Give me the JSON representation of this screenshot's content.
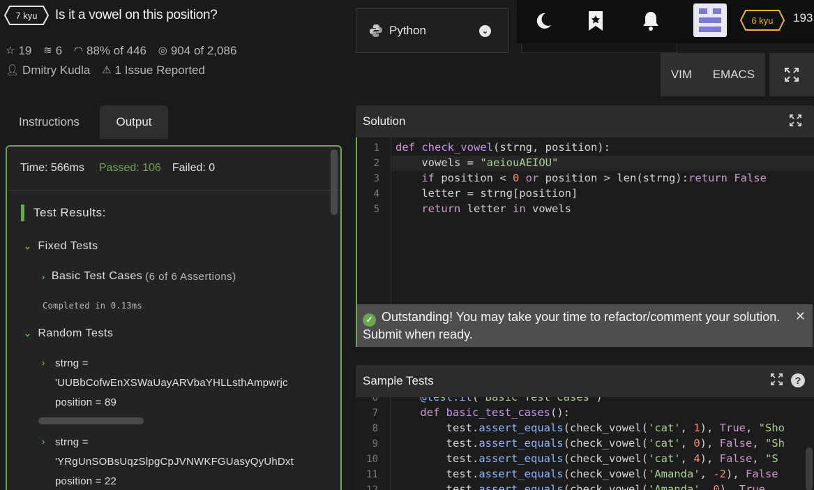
{
  "kata": {
    "rank": "7 kyu",
    "title": "Is it a vowel on this position?",
    "stars": "19",
    "collections": "6",
    "satisfaction_pct": "88%",
    "satisfaction_of": "of 446",
    "completions": "904",
    "completions_of": "of 2,086",
    "author": "Dmitry Kudla",
    "issues": "1 Issue Reported"
  },
  "language": {
    "selected": "Python"
  },
  "topbar": {
    "icons": [
      "moon-icon",
      "bookmark-star-icon",
      "bell-icon"
    ],
    "user_rank": "6 kyu",
    "honor": "193"
  },
  "editor_modes": {
    "vim": "VIM",
    "emacs": "EMACS"
  },
  "tabs": {
    "instructions": "Instructions",
    "output": "Output"
  },
  "output": {
    "time": "Time: 566ms",
    "passed": "Passed: 106",
    "failed": "Failed: 0",
    "test_results": "Test Results:",
    "fixed_tests": "Fixed Tests",
    "basic_cases": "Basic Test Cases",
    "basic_cases_count": "(6 of 6 Assertions)",
    "completed": "Completed in 0.13ms",
    "random_tests": "Random Tests",
    "random_items": [
      {
        "l1": "strng =",
        "l2": "'UUBbCofwEnXSWaUayARVbaYHLLsthAmpwrjc",
        "l3": "position = 89"
      },
      {
        "l1": "strng =",
        "l2": "'YRgUnSOBsUqzSlpgCpJVNWKFGUasyQyUhDxt",
        "l3": "position = 22"
      }
    ]
  },
  "solution": {
    "header": "Solution",
    "lines": [
      "1",
      "2",
      "3",
      "4",
      "5"
    ]
  },
  "banner": {
    "message": "Outstanding! You may take your time to refactor/comment your solution. Submit when ready."
  },
  "sample_tests": {
    "header": "Sample Tests",
    "lines": [
      "6",
      "7",
      "8",
      "9",
      "10",
      "11",
      "12"
    ]
  },
  "colors": {
    "accent_green": "#6aa84f",
    "rank_yellow": "#ecb613",
    "background": "#1a1a1a"
  }
}
